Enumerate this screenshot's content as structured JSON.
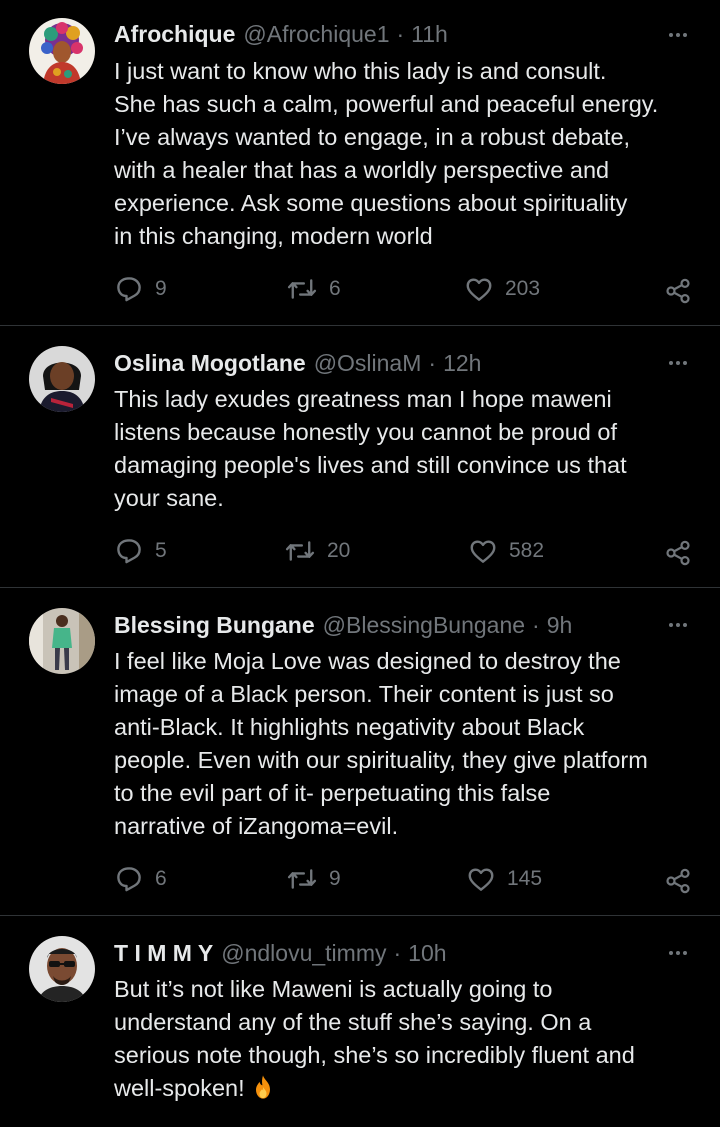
{
  "tweets": [
    {
      "name": "Afrochique",
      "handle": "@Afrochique1",
      "time": "11h",
      "text": "I just want to know who this lady is and consult.\nShe has such a calm, powerful and peaceful energy.\nI’ve always wanted to engage, in a robust debate,\nwith a healer that has a worldly perspective and\nexperience. Ask some questions about spirituality\nin this changing, modern world",
      "replies": "9",
      "retweets": "6",
      "likes": "203",
      "avatar_icon": "colorful-portrait-avatar"
    },
    {
      "name": "Oslina Mogotlane",
      "handle": "@OslinaM",
      "time": "12h",
      "text": "This lady exudes greatness man I hope maweni\nlistens because honestly you cannot be proud of\ndamaging people's lives and still convince us that\nyour sane.",
      "replies": "5",
      "retweets": "20",
      "likes": "582",
      "avatar_icon": "woman-portrait-avatar"
    },
    {
      "name": "Blessing Bungane",
      "handle": "@BlessingBungane",
      "time": "9h",
      "text": "I feel like Moja Love was designed to destroy the\nimage of a Black person. Their content is just so\nanti-Black. It highlights negativity about Black\npeople. Even with our spirituality, they give platform\nto the evil part of it- perpetuating this false\nnarrative of iZangoma=evil.",
      "replies": "6",
      "retweets": "9",
      "likes": "145",
      "avatar_icon": "full-body-photo-avatar"
    },
    {
      "name": "T I M M Y",
      "handle": "@ndlovu_timmy",
      "time": "10h",
      "text": "But it’s not like Maweni is actually going to\nunderstand any of the stuff she’s saying. On a\nserious note though, she’s so incredibly fluent and\nwell-spoken!",
      "replies": "",
      "retweets": "",
      "likes": "",
      "avatar_icon": "man-sunglasses-avatar",
      "trailing_emoji": "fire-emoji"
    }
  ],
  "colors": {
    "background": "#000000",
    "primary_text": "#e7e9ea",
    "secondary_text": "#71767b",
    "divider": "#2f3336"
  }
}
